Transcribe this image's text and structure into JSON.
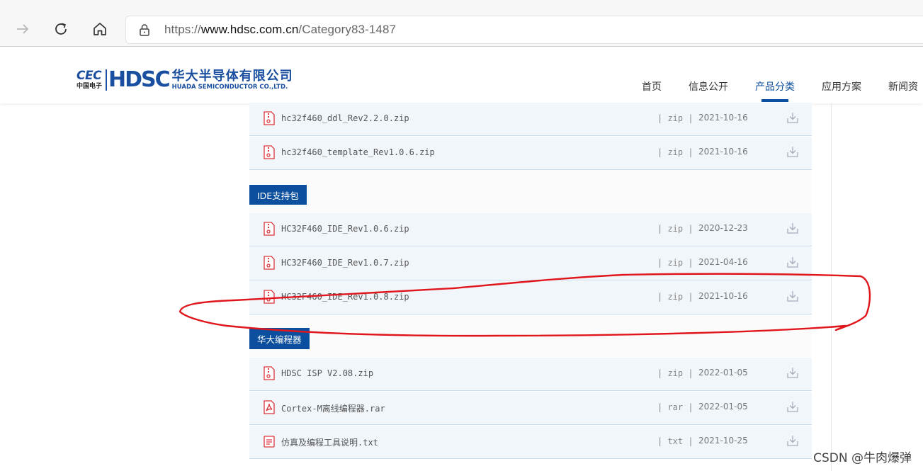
{
  "browser": {
    "url_prefix": "https://",
    "url_host": "www.hdsc.com.cn",
    "url_path": "/Category83-1487",
    "icons": [
      "forward-arrow-icon",
      "refresh-icon",
      "home-icon",
      "lock-icon"
    ]
  },
  "site": {
    "logo": {
      "cec": "CEC",
      "cec_sub": "中国电子",
      "hdsc": "HDSC",
      "name_cn": "华大半导体有限公司",
      "name_en": "HUADA SEMICONDUCTOR CO.,LTD."
    },
    "nav": [
      "首页",
      "信息公开",
      "产品分类",
      "应用方案",
      "新闻资"
    ],
    "active_nav": "产品分类"
  },
  "sections": [
    {
      "title": "",
      "files": [
        {
          "name": "hc32f460_ddl_Rev2.2.0.zip",
          "type": "zip",
          "date": "2021-10-16",
          "icon": "zip-file-icon"
        },
        {
          "name": "hc32f460_template_Rev1.0.6.zip",
          "type": "zip",
          "date": "2021-10-16",
          "icon": "zip-file-icon"
        }
      ]
    },
    {
      "title": "IDE支持包",
      "files": [
        {
          "name": "HC32F460_IDE_Rev1.0.6.zip",
          "type": "zip",
          "date": "2020-12-23",
          "icon": "zip-file-icon"
        },
        {
          "name": "HC32F460_IDE_Rev1.0.7.zip",
          "type": "zip",
          "date": "2021-04-16",
          "icon": "zip-file-icon"
        },
        {
          "name": "HC32F460_IDE_Rev1.0.8.zip",
          "type": "zip",
          "date": "2021-10-16",
          "icon": "zip-file-icon"
        }
      ]
    },
    {
      "title": "华大编程器",
      "files": [
        {
          "name": "HDSC ISP V2.08.zip",
          "type": "zip",
          "date": "2022-01-05",
          "icon": "zip-file-icon"
        },
        {
          "name": "Cortex-M离线编程器.rar",
          "type": "rar",
          "date": "2022-01-05",
          "icon": "pdf-file-icon"
        },
        {
          "name": "仿真及编程工具说明.txt",
          "type": "txt",
          "date": "2021-10-25",
          "icon": "txt-file-icon"
        }
      ]
    }
  ],
  "colors": {
    "accent": "#0c4f9e",
    "row_bg": "#f1f6fb",
    "row_border": "#c9dbec",
    "annotation": "#e0161c",
    "file_icon": "#d9363e"
  },
  "watermark": "CSDN @牛肉爆弹"
}
